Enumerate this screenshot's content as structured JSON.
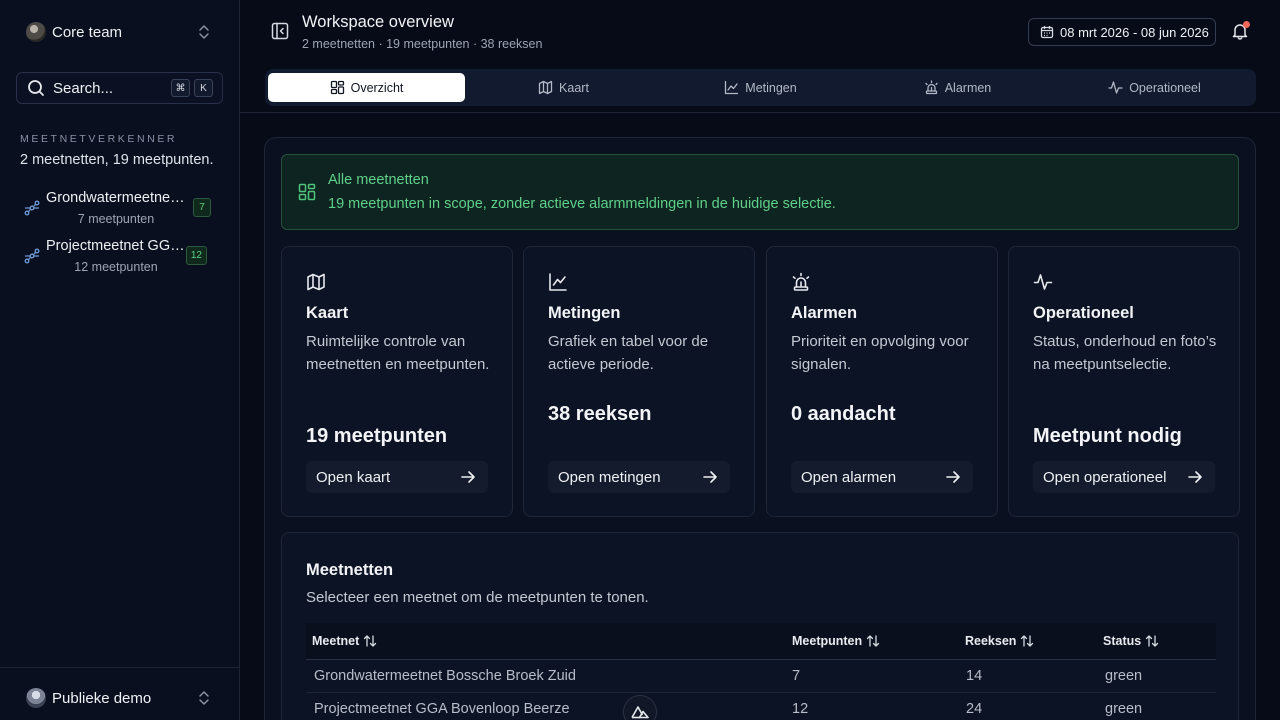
{
  "sidebar": {
    "team": "Core team",
    "search_placeholder": "Search...",
    "kbd": [
      "⌘",
      "K"
    ],
    "section_label": "MEETNETVERKENNER",
    "summary": "2 meetnetten, 19 meetpunten.",
    "networks": [
      {
        "name": "Grondwatermeetnet Bossche Broek Zuid",
        "count": "7 meetpunten",
        "badge": "7"
      },
      {
        "name": "Projectmeetnet GGA Bovenloop Beerze",
        "count": "12 meetpunten",
        "badge": "12"
      }
    ],
    "footer": "Publieke demo"
  },
  "header": {
    "title": "Workspace overview",
    "subtitle": "2 meetnetten · 19 meetpunten · 38 reeksen",
    "date_range": "08 mrt 2026 - 08 jun 2026"
  },
  "tabs": [
    {
      "label": "Overzicht",
      "icon": "layout-dashboard-icon",
      "active": true
    },
    {
      "label": "Kaart",
      "icon": "map-icon"
    },
    {
      "label": "Metingen",
      "icon": "chart-line-icon"
    },
    {
      "label": "Alarmen",
      "icon": "siren-icon"
    },
    {
      "label": "Operationeel",
      "icon": "activity-icon"
    }
  ],
  "alert": {
    "title": "Alle meetnetten",
    "description": "19 meetpunten in scope, zonder actieve alarmmeldingen in de huidige selectie."
  },
  "cards": [
    {
      "title": "Kaart",
      "description": "Ruimtelijke controle van meetnetten en meetpunten.",
      "value": "19 meetpunten",
      "button": "Open kaart"
    },
    {
      "title": "Metingen",
      "description": "Grafiek en tabel voor de actieve periode.",
      "value": "38 reeksen",
      "button": "Open metingen"
    },
    {
      "title": "Alarmen",
      "description": "Prioriteit en opvolging voor signalen.",
      "value": "0 aandacht",
      "button": "Open alarmen"
    },
    {
      "title": "Operationeel",
      "description": "Status, onderhoud en foto’s na meetpuntselectie.",
      "value": "Meetpunt nodig",
      "button": "Open operationeel"
    }
  ],
  "table": {
    "title": "Meetnetten",
    "description": "Selecteer een meetnet om de meetpunten te tonen.",
    "columns": [
      "Meetnet",
      "Meetpunten",
      "Reeksen",
      "Status"
    ],
    "rows": [
      [
        "Grondwatermeetnet Bossche Broek Zuid",
        "7",
        "14",
        "green"
      ],
      [
        "Projectmeetnet GGA Bovenloop Beerze",
        "12",
        "24",
        "green"
      ]
    ]
  },
  "colors": {
    "background": "#070b18",
    "accent_green": "#5fd08a",
    "notification": "#f2665a",
    "active_tab": "#ffffff"
  }
}
